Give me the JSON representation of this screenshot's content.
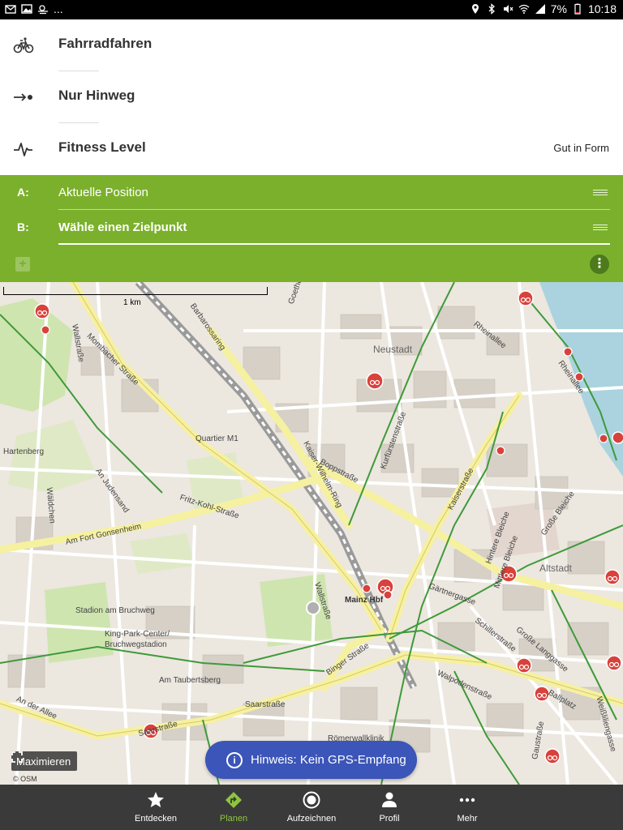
{
  "statusbar": {
    "overflow": "...",
    "battery": "7%",
    "time": "10:18"
  },
  "settings": {
    "sport": {
      "label": "Fahrradfahren",
      "icon": "bicycle-icon"
    },
    "direction": {
      "label": "Nur Hinweg",
      "icon": "one-way-arrow-icon"
    },
    "fitness": {
      "label": "Fitness Level",
      "value": "Gut in Form",
      "icon": "pulse-icon"
    }
  },
  "route": {
    "a_key": "A:",
    "a_value": "Aktuelle Position",
    "b_key": "B:",
    "b_value": "Wähle einen Zielpunkt",
    "add": "+",
    "more": "⋮"
  },
  "map": {
    "scale": "1 km",
    "labels": {
      "neustadt": "Neustadt",
      "altstadt": "Altstadt",
      "quartier": "Quartier M1",
      "hartenberg": "Hartenberg",
      "mainz_hbf": "Mainz Hbf",
      "stadion": "Stadion am Bruchweg",
      "kingpark1": "King-Park-Center/",
      "kingpark2": "Bruchwegstadion",
      "taubertsberg": "Am Taubertsberg",
      "gonsenheim": "Am Fort Gonsenheim",
      "allee": "An der Allee",
      "saarstrasse": "Saarstraße",
      "saarstrasse2": "Saarstraße",
      "barbarossa": "Barbarossaring",
      "mombacher": "Mombacher Straße",
      "boppstrasse": "Boppstraße",
      "kaiserstrasse": "Kaiserstraße",
      "rheinallee": "Rheinallee",
      "rheinallee2": "Rheinallee",
      "binger": "Binger Straße",
      "grosse_bleiche": "Große Bleiche",
      "gaertnergasse": "Gärtnergasse",
      "walpoden": "Walpodenstraße",
      "langgasse": "Große Langgasse",
      "schiller": "Schillerstraße",
      "kaiser_wilhelm": "Kaiser-Wilhelm-Ring",
      "fritz_kohl": "Fritz-Kohl-Straße",
      "wallstrasse": "Wallstraße",
      "wallstrasse2": "Wallstraße",
      "kurfuersten": "Kurfürstenstraße",
      "roemerwall": "Römerwallklinik",
      "hintere_bleiche": "Hintere Bleiche",
      "mittlere_bleiche": "Mittlere Bleiche",
      "ballplatz": "Ballplatz",
      "weisslilien": "Weißliliengasse",
      "gaustrasse": "Gaustraße",
      "judensand": "An Judensand",
      "waldchen": "Wäldchen",
      "goethe": "Goethe",
      "mainz_bf_bhf": "Mainz Hbf"
    },
    "maximize_label": "Maximieren",
    "attribution": "© OSM",
    "gps_notice": "Hinweis: Kein GPS-Empfang"
  },
  "nav": [
    {
      "label": "Entdecken",
      "icon": "star-icon"
    },
    {
      "label": "Planen",
      "icon": "route-sign-icon"
    },
    {
      "label": "Aufzeichnen",
      "icon": "record-icon"
    },
    {
      "label": "Profil",
      "icon": "person-icon"
    },
    {
      "label": "Mehr",
      "icon": "more-dots-icon"
    }
  ],
  "colors": {
    "accent_green": "#7bb02c",
    "notice_blue": "#3b55b8",
    "nav_bg": "#3a3a3a",
    "poi_red": "#d9413b"
  }
}
